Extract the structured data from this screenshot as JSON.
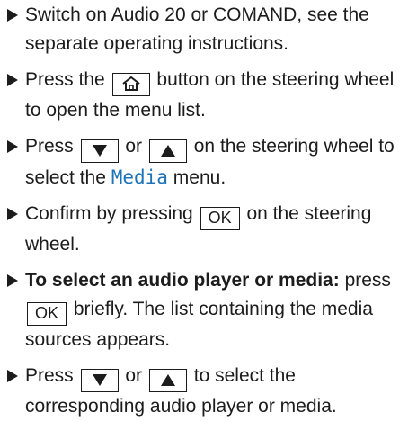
{
  "steps": [
    {
      "text": "Switch on Audio 20 or COMAND, see the separate operating instructions."
    },
    {
      "before": "Press the",
      "after": "button on the steering wheel to open the menu list.",
      "key_icon": "home-icon"
    },
    {
      "before": "Press",
      "or": "or",
      "mid": "on the steering wheel to select the",
      "menu_name": "Media",
      "end": "menu.",
      "key_icons": [
        "down-triangle-icon",
        "up-triangle-icon"
      ]
    },
    {
      "before": "Confirm by pressing",
      "key": "OK",
      "after": "on the steering wheel."
    },
    {
      "bold": "To select an audio player or media:",
      "before": "press",
      "key": "OK",
      "after": "briefly. The list containing the media sources appears."
    },
    {
      "before": "Press",
      "or": "or",
      "after": "to select the corresponding audio player or media.",
      "key_icons": [
        "down-triangle-icon",
        "up-triangle-icon"
      ]
    }
  ],
  "colors": {
    "text": "#1c1c1c",
    "accent": "#1e73b8"
  }
}
